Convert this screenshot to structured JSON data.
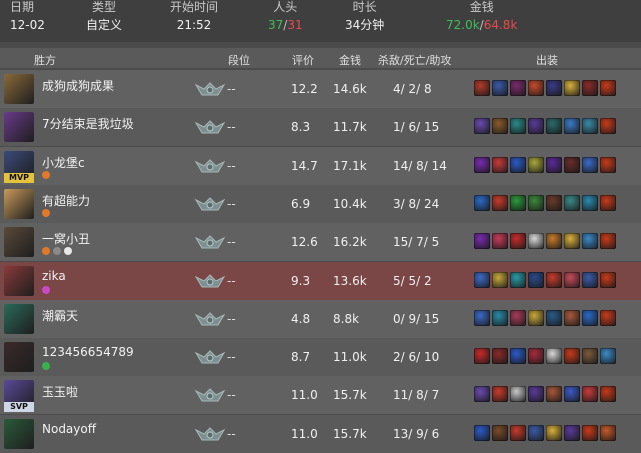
{
  "summary": {
    "date_label": "日期",
    "date": "12-02",
    "type_label": "类型",
    "type": "自定义",
    "start_label": "开始时间",
    "start": "21:52",
    "kills_label": "人头",
    "kills_blue": "37",
    "kills_sep": "/",
    "kills_red": "31",
    "duration_label": "时长",
    "duration": "34分钟",
    "gold_label": "金钱",
    "gold_blue": "72.0k",
    "gold_sep": "/",
    "gold_red": "64.8k"
  },
  "table_header": {
    "side": "胜方",
    "tier": "段位",
    "score": "评价",
    "gold": "金钱",
    "kda": "杀敌/死亡/助攻",
    "items": "出装"
  },
  "players": [
    {
      "name": "成狗成狗成果",
      "tier": "--",
      "score": "12.2",
      "gold": "14.6k",
      "k": "4",
      "d": "2",
      "a": "8",
      "badge": "",
      "avatar": "#8a6a3a",
      "badges": [],
      "items": [
        "#b23a2a",
        "#3a5aa8",
        "#7a2a6a",
        "#c84a2a",
        "#3a3a8a",
        "#d8b03a",
        "#8a2a2a",
        "#c83a1a"
      ]
    },
    {
      "name": "7分结束是我垃圾",
      "tier": "--",
      "score": "8.3",
      "gold": "11.7k",
      "k": "1",
      "d": "6",
      "a": "15",
      "badge": "",
      "avatar": "#6a3a8a",
      "badges": [],
      "items": [
        "#6a4ab0",
        "#8a5a2a",
        "#2a8a8a",
        "#5a3a9a",
        "#2a6a6a",
        "#3a7ac8",
        "#3a8aa8",
        "#c83a1a"
      ]
    },
    {
      "name": "小龙堡c",
      "tier": "--",
      "score": "14.7",
      "gold": "17.1k",
      "k": "14",
      "d": "8",
      "a": "14",
      "badge": "MVP",
      "avatar": "#3a4a7a",
      "badges": [
        "#e07a2a"
      ],
      "items": [
        "#7a2ab0",
        "#c83a3a",
        "#2a5ac8",
        "#a8a83a",
        "#5a2a9a",
        "#6a2a2a",
        "#3a6ac8",
        "#c83a1a"
      ]
    },
    {
      "name": "有超能力",
      "tier": "--",
      "score": "6.9",
      "gold": "10.4k",
      "k": "3",
      "d": "8",
      "a": "24",
      "badge": "",
      "avatar": "#c89a5a",
      "badges": [
        "#e07a2a"
      ],
      "items": [
        "#2a6ac8",
        "#c83a2a",
        "#2a9a3a",
        "#3a8a3a",
        "#6a3a2a",
        "#3a8a8a",
        "#2a8ab0",
        "#c83a1a"
      ]
    },
    {
      "name": "一窝小丑",
      "tier": "--",
      "score": "12.6",
      "gold": "16.2k",
      "k": "15",
      "d": "7",
      "a": "5",
      "badge": "",
      "avatar": "#5a4a3a",
      "badges": [
        "#e07a2a",
        "#8a8a8a",
        "#e8e8e8"
      ],
      "items": [
        "#7a2ab0",
        "#c83a5a",
        "#c82a2a",
        "#d8d8d8",
        "#c87a2a",
        "#d8b03a",
        "#3a8ac8",
        "#c83a1a"
      ]
    },
    {
      "name": "zika",
      "tier": "--",
      "score": "9.3",
      "gold": "13.6k",
      "k": "5",
      "d": "5",
      "a": "2",
      "badge": "",
      "avatar": "#8a3a3a",
      "badges": [
        "#c84ac8"
      ],
      "items": [
        "#3a6ac8",
        "#c8a83a",
        "#2a9aa8",
        "#2a4a8a",
        "#c83a2a",
        "#c84a5a",
        "#3a5aa8",
        "#c83a1a"
      ]
    },
    {
      "name": "潮霸天",
      "tier": "--",
      "score": "4.8",
      "gold": "8.8k",
      "k": "0",
      "d": "9",
      "a": "15",
      "badge": "",
      "avatar": "#2a6a5a",
      "badges": [],
      "items": [
        "#3a6ac8",
        "#2a8aa8",
        "#a83a5a",
        "#c8a83a",
        "#2a5a8a",
        "#a8583a",
        "#2a6ac8",
        "#c83a1a"
      ]
    },
    {
      "name": "123456654789",
      "tier": "--",
      "score": "8.7",
      "gold": "11.0k",
      "k": "2",
      "d": "6",
      "a": "10",
      "badge": "",
      "avatar": "#3a2a2a",
      "badges": [
        "#3ab04a"
      ],
      "items": [
        "#c82a2a",
        "#8a2a2a",
        "#2a5ac8",
        "#a82a3a",
        "#d8d8d8",
        "#c83a1a",
        "#7a5a3a",
        "#3a8ac8"
      ]
    },
    {
      "name": "玉玉啦",
      "tier": "--",
      "score": "11.0",
      "gold": "15.7k",
      "k": "11",
      "d": "8",
      "a": "7",
      "badge": "SVP",
      "avatar": "#5a4a9a",
      "badges": [],
      "items": [
        "#6a4ab0",
        "#c83a2a",
        "#c8c8c8",
        "#5a3a9a",
        "#a8583a",
        "#3a5ac8",
        "#c83a3a",
        "#c83a1a"
      ]
    },
    {
      "name": "Nodayoff",
      "tier": "--",
      "score": "11.0",
      "gold": "15.7k",
      "k": "13",
      "d": "9",
      "a": "6",
      "badge": "",
      "avatar": "#2a5a3a",
      "badges": [],
      "items": [
        "#2a5ac8",
        "#7a4a2a",
        "#c83a2a",
        "#3a5aa8",
        "#d8b03a",
        "#5a3a9a",
        "#c83a1a",
        "#c8582a"
      ]
    }
  ]
}
